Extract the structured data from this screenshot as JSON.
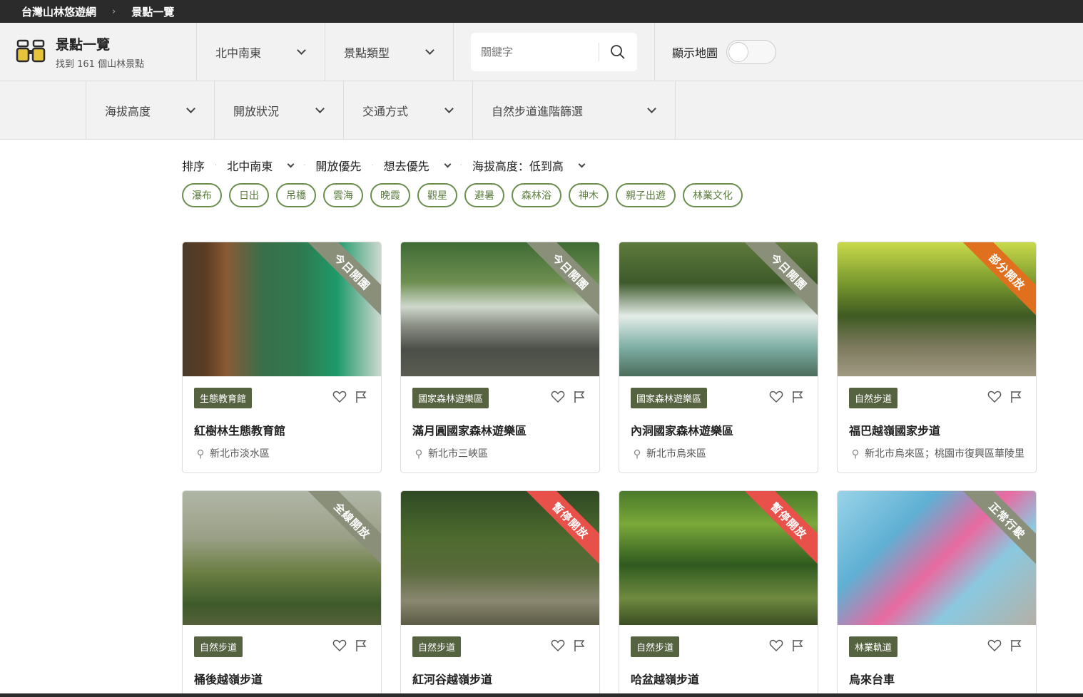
{
  "breadcrumb": {
    "home": "台灣山林悠遊網",
    "current": "景點一覽"
  },
  "brand": {
    "title": "景點一覽",
    "subtitle": "找到 161 個山林景點"
  },
  "filters": {
    "region": "北中南東",
    "type": "景點類型"
  },
  "search": {
    "placeholder": "關鍵字"
  },
  "map_toggle": {
    "label": "顯示地圖",
    "on": false
  },
  "filters2": [
    "海拔高度",
    "開放狀況",
    "交通方式",
    "自然步道進階篩選"
  ],
  "sort": {
    "label": "排序",
    "region": "北中南東",
    "open_first": "開放優先",
    "want_first": "想去優先",
    "altitude": "海拔高度：低到高"
  },
  "tags": [
    "瀑布",
    "日出",
    "吊橋",
    "雲海",
    "晚霞",
    "觀星",
    "避暑",
    "森林浴",
    "神木",
    "親子出遊",
    "林業文化"
  ],
  "cards": [
    {
      "status": "今日開園",
      "status_color": "#8a8f7a",
      "category": "生態教育館",
      "name": "紅樹林生態教育館",
      "location": "新北市淡水區"
    },
    {
      "status": "今日開園",
      "status_color": "#8a8f7a",
      "category": "國家森林遊樂區",
      "name": "滿月圓國家森林遊樂區",
      "location": "新北市三峽區"
    },
    {
      "status": "今日開園",
      "status_color": "#8a8f7a",
      "category": "國家森林遊樂區",
      "name": "內洞國家森林遊樂區",
      "location": "新北市烏來區"
    },
    {
      "status": "部分開放",
      "status_color": "#e0701e",
      "category": "自然步道",
      "name": "福巴越嶺國家步道",
      "location": "新北市烏來區；桃園市復興區華陵里"
    },
    {
      "status": "全線開放",
      "status_color": "#8a8f7a",
      "category": "自然步道",
      "name": "桶後越嶺步道",
      "location": ""
    },
    {
      "status": "暫停開放",
      "status_color": "#e8504a",
      "category": "自然步道",
      "name": "紅河谷越嶺步道",
      "location": ""
    },
    {
      "status": "暫停開放",
      "status_color": "#e8504a",
      "category": "自然步道",
      "name": "哈盆越嶺步道",
      "location": ""
    },
    {
      "status": "正常行駛",
      "status_color": "#8a8f7a",
      "category": "林業軌道",
      "name": "烏來台車",
      "location": ""
    }
  ]
}
